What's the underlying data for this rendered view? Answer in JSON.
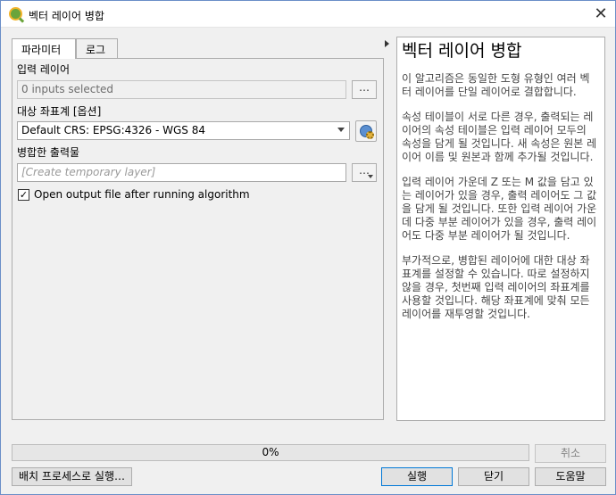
{
  "window": {
    "title": "벡터 레이어 병합",
    "close_glyph": "✕",
    "app_icon": "qgis-logo-icon"
  },
  "tabs": [
    {
      "label": "파라미터",
      "active": true
    },
    {
      "label": "로그",
      "active": false
    }
  ],
  "params": {
    "input_layers": {
      "label": "입력 레이어",
      "value": "0 inputs selected",
      "browse_label": "…"
    },
    "target_crs": {
      "label": "대상 좌표계 [옵션]",
      "value": "Default CRS: EPSG:4326 - WGS 84",
      "select_crs_icon": "crs-select-icon"
    },
    "output": {
      "label": "병합한 출력물",
      "placeholder": "[Create temporary layer]",
      "browse_label": "…"
    },
    "open_output": {
      "checked": true,
      "check_glyph": "✓",
      "label": "Open output file after running algorithm"
    }
  },
  "help": {
    "title": "벡터 레이어 병합",
    "paragraphs": [
      "이 알고리즘은 동일한 도형 유형인 여러 벡터 레이어를 단일 레이어로 결합합니다.",
      "속성 테이블이 서로 다른 경우, 출력되는 레이어의 속성 테이블은 입력 레이어 모두의 속성을 담게 될 것입니다. 새 속성은 원본 레이어 이름 및 원본과 함께 추가될 것입니다.",
      "입력 레이어 가운데 Z 또는 M 값을 담고 있는 레이어가 있을 경우, 출력 레이어도 그 값을 담게 될 것입니다. 또한 입력 레이어 가운데 다중 부분 레이어가 있을 경우, 출력 레이어도 다중 부분 레이어가 될 것입니다.",
      "부가적으로, 병합된 레이어에 대한 대상 좌표계를 설정할 수 있습니다. 따로 설정하지 않을 경우, 첫번째 입력 레이어의 좌표계를 사용할 것입니다. 해당 좌표계에 맞춰 모든 레이어를 재투영할 것입니다."
    ]
  },
  "progress": {
    "text": "0%",
    "value": 0
  },
  "buttons": {
    "cancel": "취소",
    "batch": "배치 프로세스로 실행…",
    "run": "실행",
    "close": "닫기",
    "help": "도움말"
  }
}
